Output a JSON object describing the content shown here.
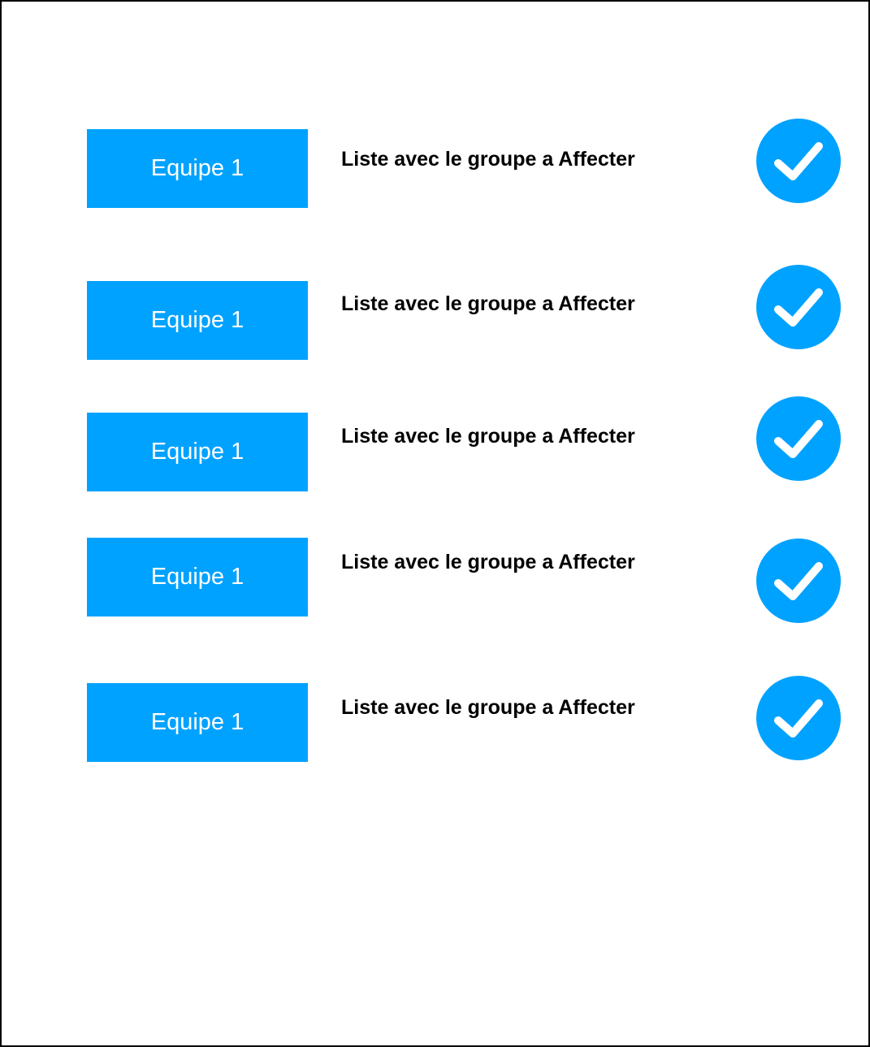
{
  "rows": [
    {
      "team_label": "Equipe 1",
      "assign_text": "Liste avec le groupe a Affecter",
      "confirm_icon": "check-icon"
    },
    {
      "team_label": "Equipe 1",
      "assign_text": "Liste avec le groupe a Affecter",
      "confirm_icon": "check-icon"
    },
    {
      "team_label": "Equipe 1",
      "assign_text": "Liste avec le groupe a Affecter",
      "confirm_icon": "check-icon"
    },
    {
      "team_label": "Equipe 1",
      "assign_text": "Liste avec le groupe a Affecter",
      "confirm_icon": "check-icon"
    },
    {
      "team_label": "Equipe 1",
      "assign_text": "Liste avec le groupe a Affecter",
      "confirm_icon": "check-icon"
    }
  ],
  "colors": {
    "accent": "#00a2ff",
    "text": "#000000",
    "button_text": "#ffffff",
    "border": "#000000"
  }
}
